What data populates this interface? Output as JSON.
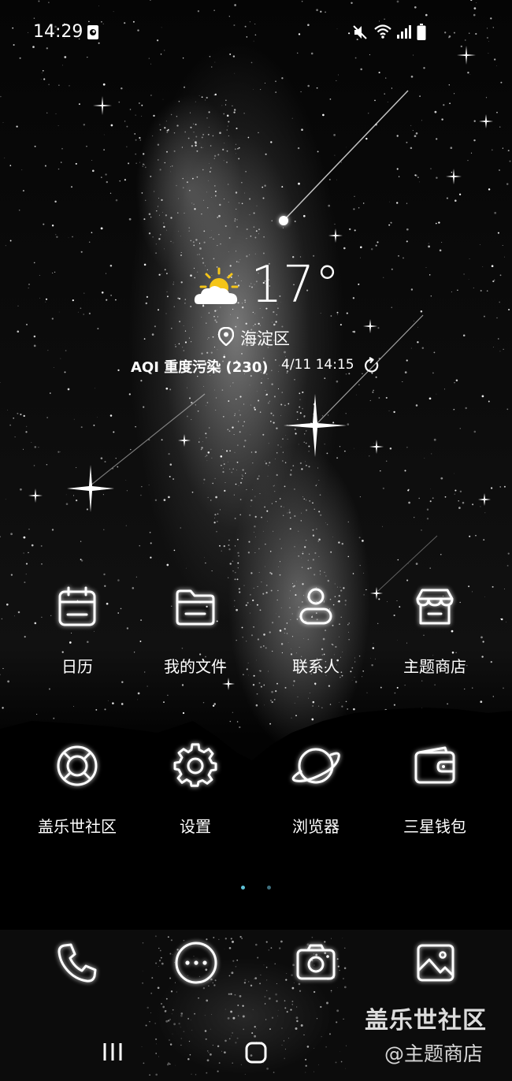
{
  "status_bar": {
    "time": "14:29",
    "icons": [
      "notification-icon",
      "mute-icon",
      "wifi-icon",
      "signal-icon",
      "battery-icon"
    ]
  },
  "weather": {
    "icon": "partly-sunny-icon",
    "temperature": "17°",
    "location": "海淀区",
    "aqi": "AQI 重度污染 (230)",
    "updated": "4/11 14:15",
    "refresh_icon": "refresh-icon"
  },
  "apps": [
    {
      "label": "日历",
      "icon": "calendar-icon"
    },
    {
      "label": "我的文件",
      "icon": "folder-icon"
    },
    {
      "label": "联系人",
      "icon": "contacts-icon"
    },
    {
      "label": "主题商店",
      "icon": "theme-store-icon"
    },
    {
      "label": "盖乐世社区",
      "icon": "lifebuoy-icon"
    },
    {
      "label": "设置",
      "icon": "gear-icon"
    },
    {
      "label": "浏览器",
      "icon": "planet-icon"
    },
    {
      "label": "三星钱包",
      "icon": "wallet-icon"
    }
  ],
  "page_indicator": {
    "pages": 2,
    "current": 1
  },
  "dock": [
    {
      "icon": "phone-icon"
    },
    {
      "icon": "messages-icon"
    },
    {
      "icon": "camera-icon"
    },
    {
      "icon": "gallery-icon"
    }
  ],
  "navigation": {
    "recents_icon": "recents-icon",
    "home_icon": "home-icon"
  },
  "watermark": {
    "line1": "盖乐世社区",
    "line2": "@主题商店"
  }
}
